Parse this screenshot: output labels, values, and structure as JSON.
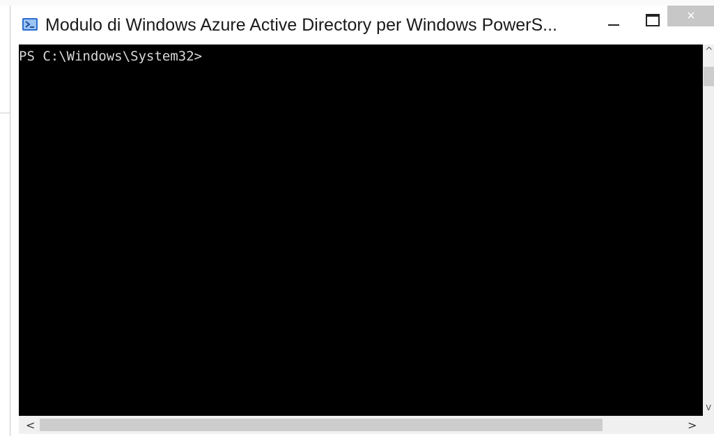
{
  "window": {
    "title": "Modulo di Windows Azure Active Directory per Windows PowerS...",
    "controls": {
      "minimize": "minimize",
      "maximize": "maximize",
      "close": "×"
    }
  },
  "console": {
    "prompt": "PS C:\\Windows\\System32>"
  },
  "scrollbars": {
    "left_arrow": "<",
    "right_arrow": ">",
    "up_arrow": "^",
    "down_arrow": "v"
  },
  "colors": {
    "console_bg": "#000000",
    "console_text": "#d8d8d8",
    "close_bg": "#c7c7c7",
    "icon_blue": "#2a6ccf"
  }
}
